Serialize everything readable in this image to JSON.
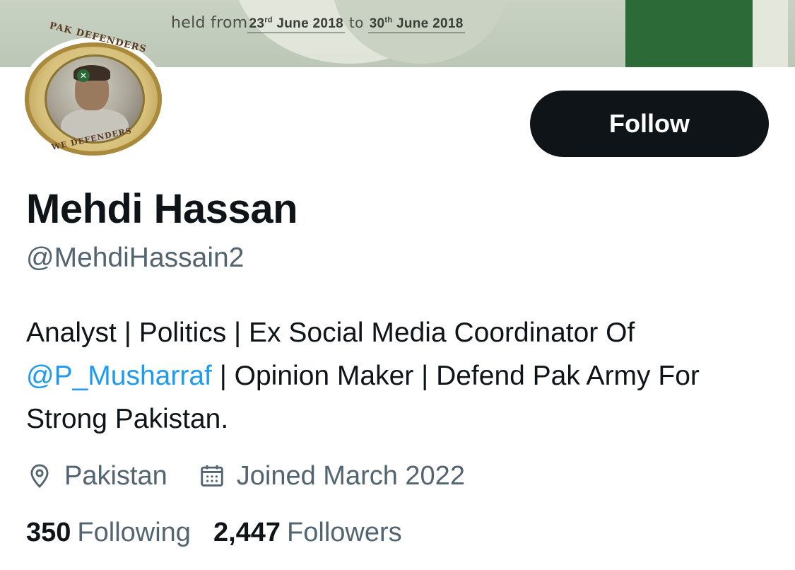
{
  "banner": {
    "prefix": "held from",
    "start_day": "23",
    "start_sup": "rd",
    "start_rest": "June 2018",
    "to": "to",
    "end_day": "30",
    "end_sup": "th",
    "end_rest": "June 2018"
  },
  "avatar": {
    "badge_top": "PAK DEFENDERS",
    "badge_bottom": "WE DEFENDERS"
  },
  "follow_label": "Follow",
  "profile": {
    "name": "Mehdi Hassan",
    "handle": "@MehdiHassain2",
    "bio_part1": "Analyst | Politics | Ex Social Media Coordinator Of",
    "bio_mention": "@P_Musharraf",
    "bio_part2": " | Opinion Maker | Defend Pak Army For Strong Pakistan.",
    "location": "Pakistan",
    "joined": "Joined March 2022",
    "location_icon": "location-pin-icon",
    "calendar_icon": "calendar-icon"
  },
  "stats": {
    "following_count": "350",
    "following_label": "Following",
    "followers_count": "2,447",
    "followers_label": "Followers"
  },
  "colors": {
    "accent": "#1d9bf0",
    "text": "#0f1419",
    "secondary": "#536471",
    "button_bg": "#0f1419",
    "flag_green": "#2c6a37"
  }
}
